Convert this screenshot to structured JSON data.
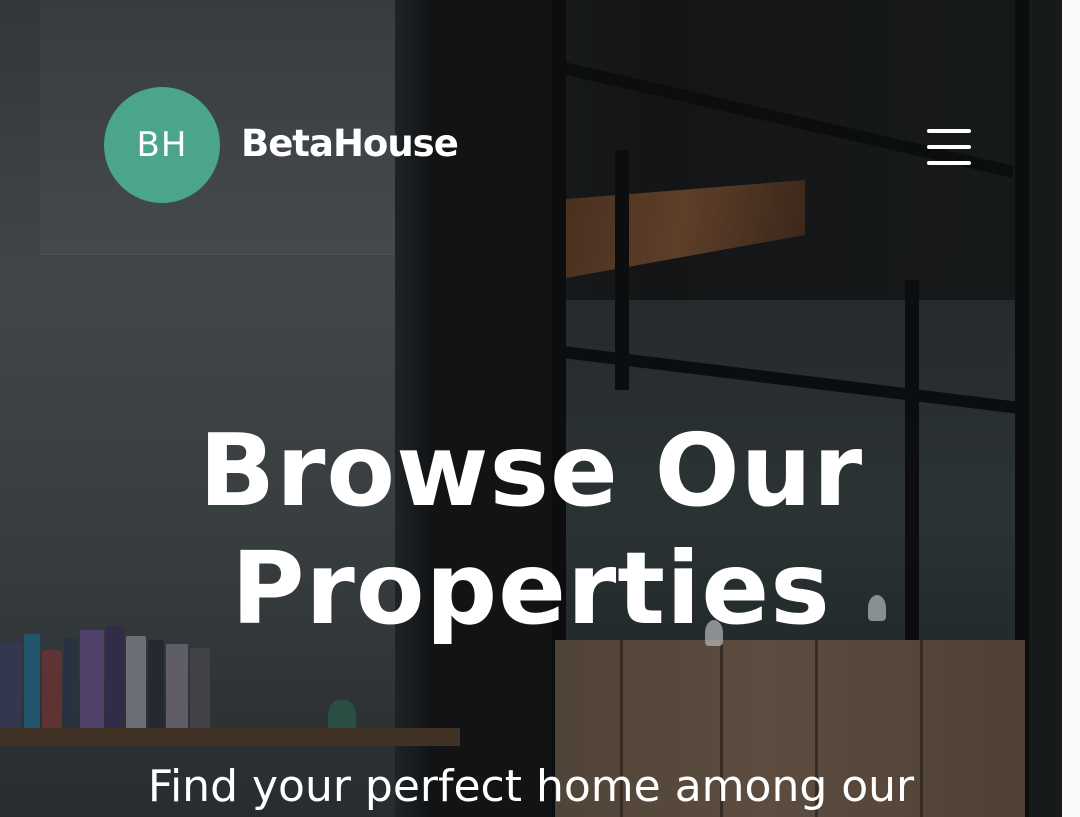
{
  "header": {
    "logo_initials": "BH",
    "brand_name": "BetaHouse",
    "menu_icon": "hamburger-menu-icon"
  },
  "hero": {
    "headline_line1": "Browse Our",
    "headline_line2": "Properties",
    "subline": "Find your perfect home among our"
  },
  "colors": {
    "brand_green": "#4aa58a",
    "text": "#ffffff"
  }
}
